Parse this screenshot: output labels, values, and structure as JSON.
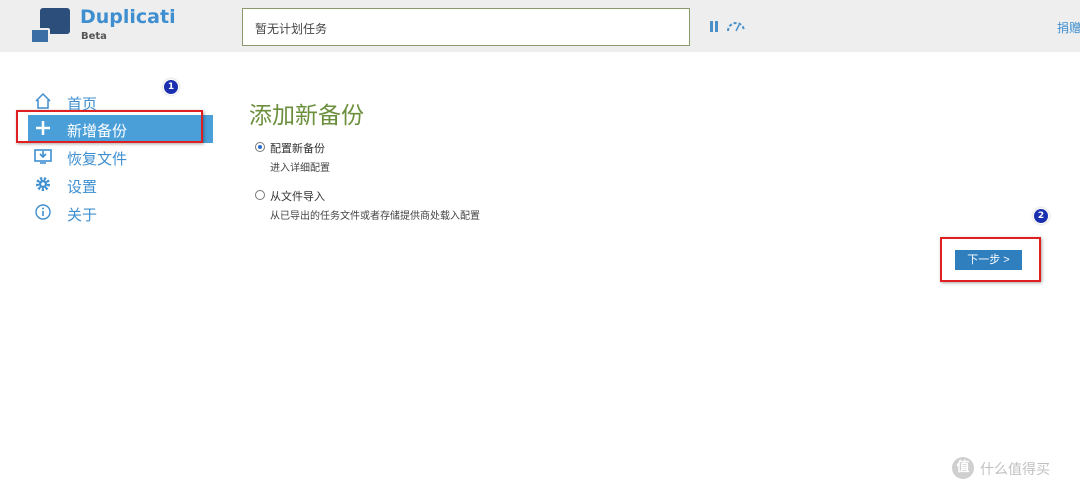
{
  "header": {
    "app_name": "Duplicati",
    "app_sub": "Beta",
    "status_text": "暂无计划任务",
    "donate_label": "捐赠"
  },
  "sidebar": {
    "items": [
      {
        "label": "首页",
        "icon": "home-icon"
      },
      {
        "label": "新增备份",
        "icon": "plus-icon",
        "active": true
      },
      {
        "label": "恢复文件",
        "icon": "restore-icon"
      },
      {
        "label": "设置",
        "icon": "gear-icon"
      },
      {
        "label": "关于",
        "icon": "info-icon"
      }
    ]
  },
  "main": {
    "title": "添加新备份",
    "options": [
      {
        "title": "配置新备份",
        "desc": "进入详细配置",
        "checked": true
      },
      {
        "title": "从文件导入",
        "desc": "从已导出的任务文件或者存储提供商处载入配置",
        "checked": false
      }
    ],
    "next_label": "下一步 >"
  },
  "annotations": {
    "badge1": "1",
    "badge2": "2"
  },
  "watermark": {
    "logo": "值",
    "text": "什么值得买"
  },
  "colors": {
    "accent": "#3f8fd0",
    "active_bg": "#4a9fd8",
    "title_green": "#6b8f3c",
    "highlight_red": "#e02020",
    "badge_blue": "#1a2fb0"
  }
}
